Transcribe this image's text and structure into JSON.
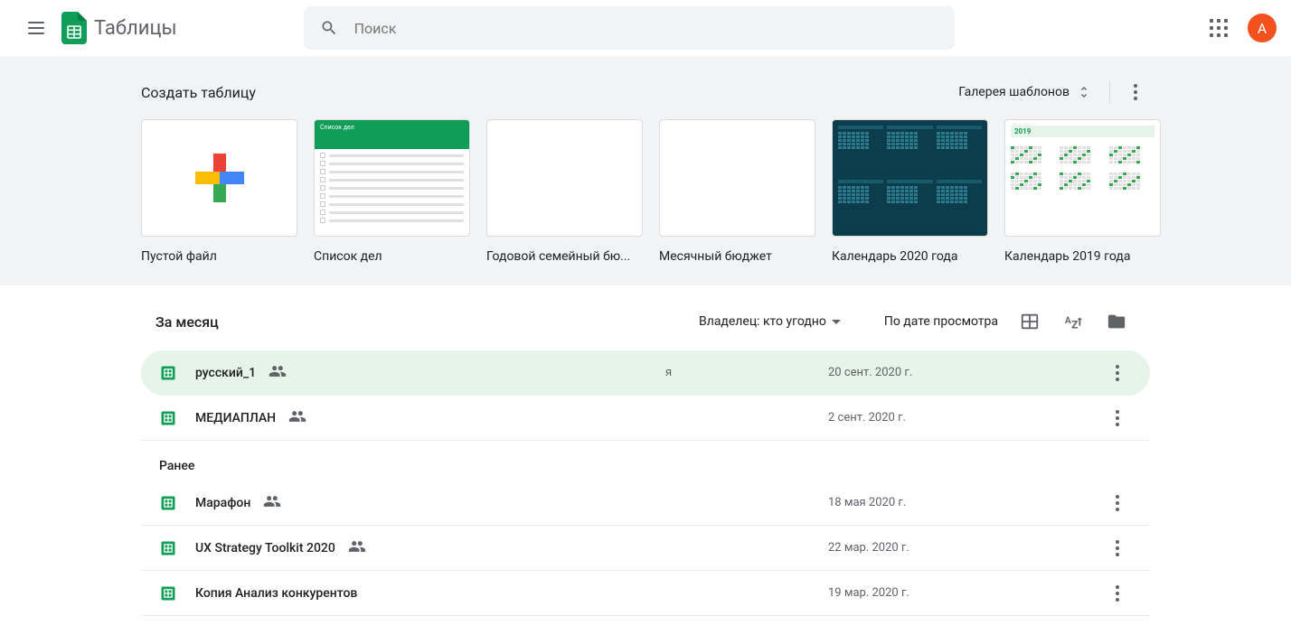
{
  "header": {
    "app_title": "Таблицы",
    "search_placeholder": "Поиск",
    "avatar_letter": "А"
  },
  "templates": {
    "title": "Создать таблицу",
    "gallery_label": "Галерея шаблонов",
    "cards": [
      {
        "label": "Пустой файл",
        "kind": "blank"
      },
      {
        "label": "Список дел",
        "kind": "todo"
      },
      {
        "label": "Годовой семейный бю...",
        "kind": "blank-thumb"
      },
      {
        "label": "Месячный бюджет",
        "kind": "blank-thumb"
      },
      {
        "label": "Календарь 2020 года",
        "kind": "cal-dark"
      },
      {
        "label": "Календарь 2019 года",
        "kind": "cal-light",
        "year": "2019"
      }
    ]
  },
  "files": {
    "owner_filter": "Владелец: кто угодно",
    "sort_label": "По дате просмотра",
    "sections": [
      {
        "label": "За месяц",
        "rows": [
          {
            "name": "русский_1",
            "owner": "я",
            "date": "20 сент. 2020 г.",
            "shared": true,
            "selected": true
          },
          {
            "name": "МЕДИАПЛАН",
            "owner": "",
            "date": "2 сент. 2020 г.",
            "shared": true,
            "selected": false
          }
        ]
      },
      {
        "label": "Ранее",
        "rows": [
          {
            "name": "Марафон",
            "owner": "",
            "date": "18 мая 2020 г.",
            "shared": true,
            "selected": false
          },
          {
            "name": "UX Strategy Toolkit 2020",
            "owner": "",
            "date": "22 мар. 2020 г.",
            "shared": true,
            "selected": false
          },
          {
            "name": "Копия Анализ конкурентов",
            "owner": "",
            "date": "19 мар. 2020 г.",
            "shared": false,
            "selected": false
          }
        ]
      }
    ]
  }
}
